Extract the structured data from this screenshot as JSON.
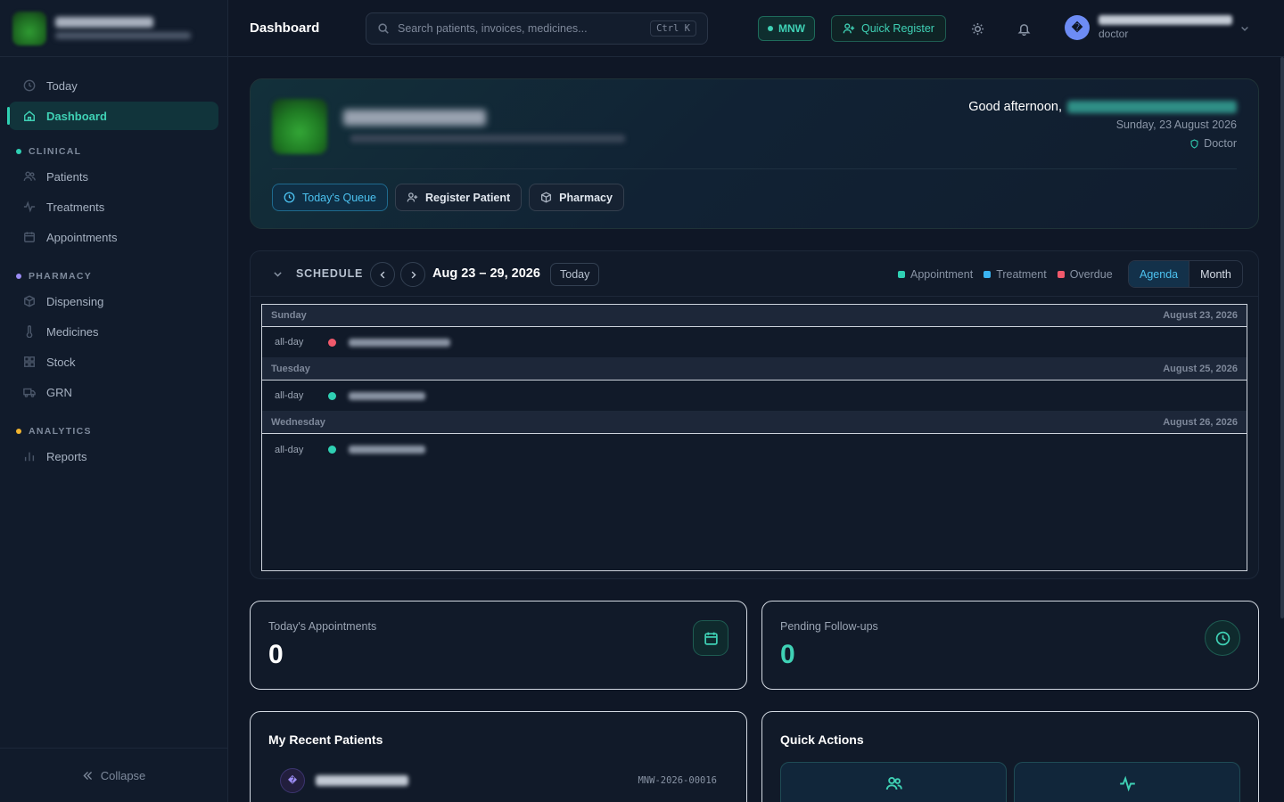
{
  "header": {
    "title": "Dashboard",
    "search_placeholder": "Search patients, invoices, medicines...",
    "search_shortcut": "Ctrl K",
    "branch": "MNW",
    "quick_register": "Quick Register",
    "user_role": "doctor",
    "avatar_glyph": "�"
  },
  "sidebar": {
    "items": [
      {
        "label": "Today",
        "icon": "clock-icon"
      },
      {
        "label": "Dashboard",
        "icon": "home-icon",
        "active": true
      }
    ],
    "sections": [
      {
        "label": "CLINICAL",
        "color": "#2fd0b3",
        "items": [
          "Patients",
          "Treatments",
          "Appointments"
        ]
      },
      {
        "label": "PHARMACY",
        "color": "#9b8cf5",
        "items": [
          "Dispensing",
          "Medicines",
          "Stock",
          "GRN"
        ]
      },
      {
        "label": "ANALYTICS",
        "color": "#f1b42f",
        "items": [
          "Reports"
        ]
      }
    ],
    "collapse": "Collapse"
  },
  "welcome": {
    "greeting": "Good afternoon,",
    "date": "Sunday, 23 August 2026",
    "role": "Doctor",
    "buttons": [
      "Today's Queue",
      "Register Patient",
      "Pharmacy"
    ]
  },
  "schedule": {
    "title": "SCHEDULE",
    "range": "Aug 23 – 29, 2026",
    "today": "Today",
    "legend": [
      {
        "label": "Appointment",
        "color": "#2fd0b3"
      },
      {
        "label": "Treatment",
        "color": "#3ab4f2"
      },
      {
        "label": "Overdue",
        "color": "#f0596b"
      }
    ],
    "views": [
      "Agenda",
      "Month"
    ],
    "days": [
      {
        "day": "Sunday",
        "date": "August 23, 2026",
        "time": "all-day",
        "color": "#f0596b"
      },
      {
        "day": "Tuesday",
        "date": "August 25, 2026",
        "time": "all-day",
        "color": "#2fd0b3"
      },
      {
        "day": "Wednesday",
        "date": "August 26, 2026",
        "time": "all-day",
        "color": "#2fd0b3"
      }
    ]
  },
  "stats": {
    "appointments": {
      "label": "Today's Appointments",
      "value": "0"
    },
    "followups": {
      "label": "Pending Follow-ups",
      "value": "0"
    }
  },
  "recent": {
    "title": "My Recent Patients",
    "patient_id": "MNW-2026-00016",
    "avatar_glyph": "�"
  },
  "quick_actions": {
    "title": "Quick Actions"
  }
}
